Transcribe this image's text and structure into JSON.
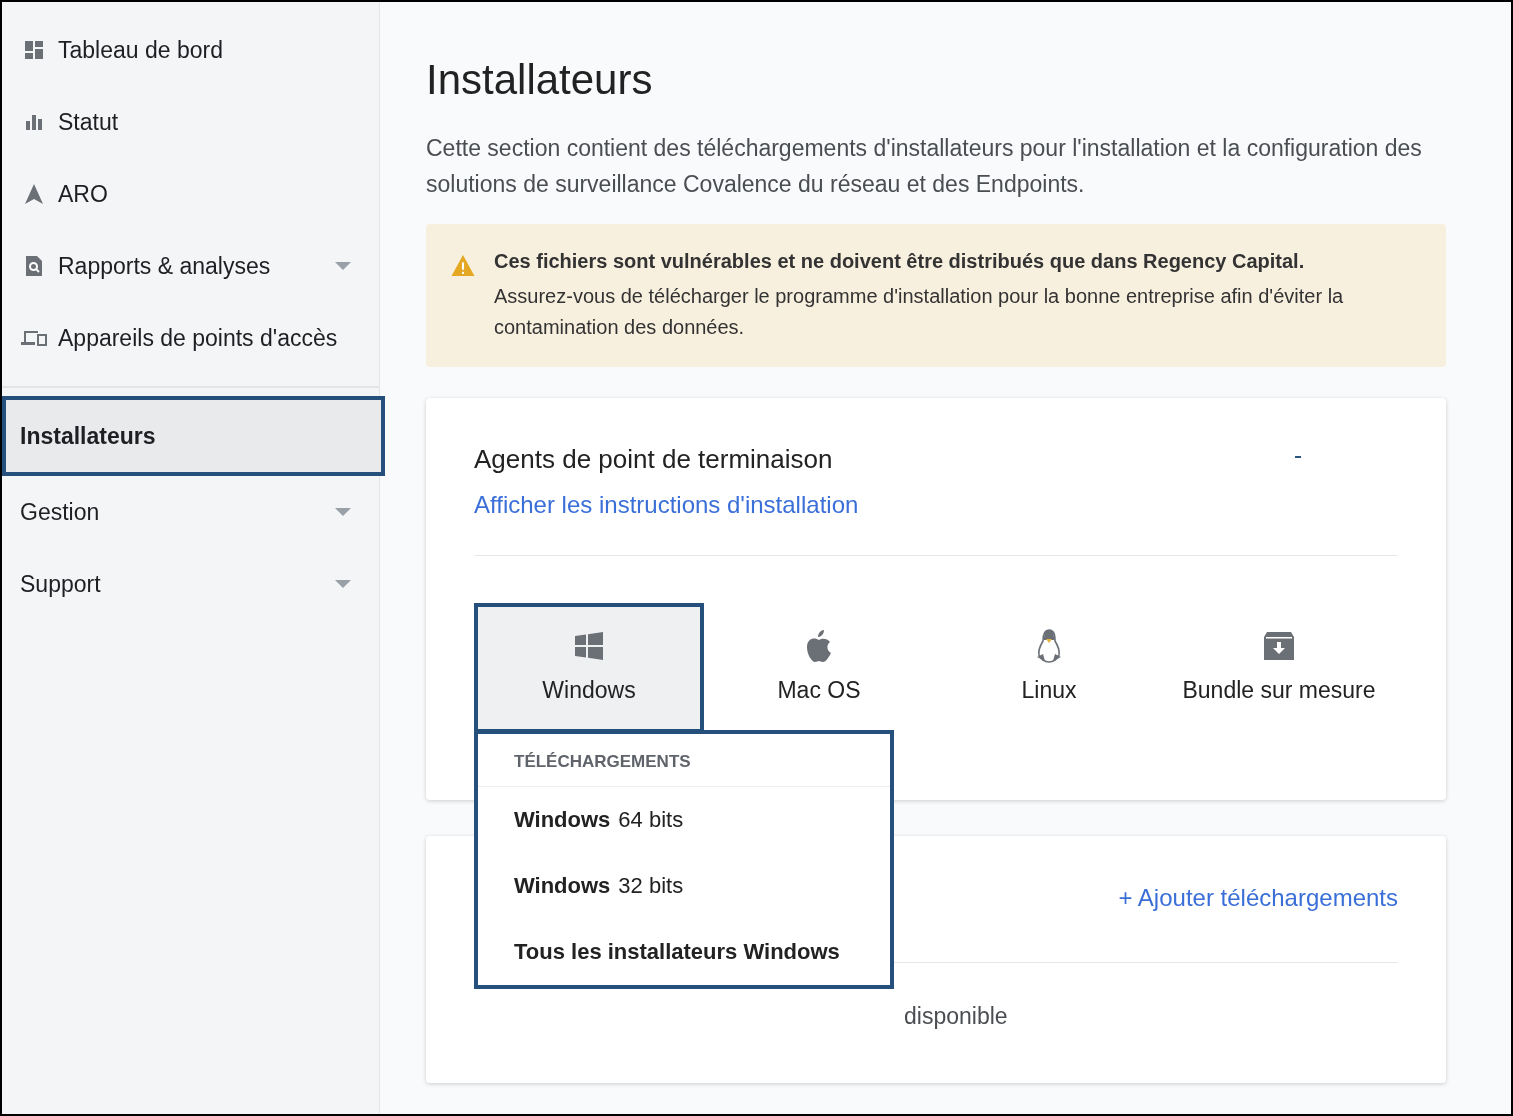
{
  "sidebar": {
    "main_items": [
      {
        "label": "Tableau de bord",
        "expandable": false
      },
      {
        "label": "Statut",
        "expandable": false
      },
      {
        "label": "ARO",
        "expandable": false
      },
      {
        "label": "Rapports & analyses",
        "expandable": true
      },
      {
        "label": "Appareils de points d'accès",
        "expandable": false
      }
    ],
    "admin_items": [
      {
        "label": "Installateurs",
        "expandable": false,
        "selected": true
      },
      {
        "label": "Gestion",
        "expandable": true,
        "selected": false
      },
      {
        "label": "Support",
        "expandable": true,
        "selected": false
      }
    ]
  },
  "page": {
    "title": "Installateurs",
    "description": "Cette section contient des téléchargements d'installateurs pour l'installation et la configuration des solutions de surveillance Covalence du réseau et des Endpoints."
  },
  "warning": {
    "title": "Ces fichiers sont vulnérables et ne doivent être distribués que dans Regency Capital.",
    "body": "Assurez-vous de télécharger le programme d'installation pour la bonne entreprise afin d'éviter la contamination des données."
  },
  "agents_card": {
    "title": "Agents de point de terminaison",
    "link": "Afficher les instructions d'installation",
    "tabs": [
      {
        "label": "Windows",
        "selected": true
      },
      {
        "label": "Mac OS",
        "selected": false
      },
      {
        "label": "Linux",
        "selected": false
      },
      {
        "label": "Bundle sur mesure",
        "selected": false
      }
    ],
    "dropdown": {
      "header": "TÉLÉCHARGEMENTS",
      "items": [
        "**Windows** 64 bits",
        "**Windows** 32 bits",
        "**Tous les installateurs Windows**"
      ]
    }
  },
  "appliance_card": {
    "add_link": "+ Ajouter téléchargements",
    "empty_text": "disponible"
  }
}
